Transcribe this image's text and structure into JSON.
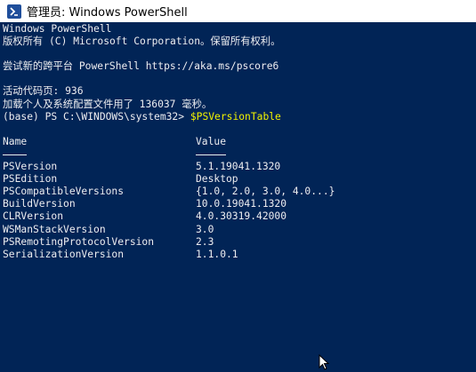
{
  "window": {
    "title": "管理员: Windows PowerShell",
    "icon": "powershell-icon"
  },
  "console": {
    "lines": [
      "Windows PowerShell",
      "版权所有 (C) Microsoft Corporation。保留所有权利。",
      "",
      "尝试新的跨平台 PowerShell https://aka.ms/pscore6",
      "",
      "活动代码页: 936",
      "加载个人及系统配置文件用了 136037 毫秒。"
    ],
    "prompt": "(base) PS C:\\WINDOWS\\system32> ",
    "command": "$PSVersionTable",
    "table": {
      "headers": [
        "Name",
        "Value"
      ],
      "rows": [
        [
          "PSVersion",
          "5.1.19041.1320"
        ],
        [
          "PSEdition",
          "Desktop"
        ],
        [
          "PSCompatibleVersions",
          "{1.0, 2.0, 3.0, 4.0...}"
        ],
        [
          "BuildVersion",
          "10.0.19041.1320"
        ],
        [
          "CLRVersion",
          "4.0.30319.42000"
        ],
        [
          "WSManStackVersion",
          "3.0"
        ],
        [
          "PSRemotingProtocolVersion",
          "2.3"
        ],
        [
          "SerializationVersion",
          "1.1.0.1"
        ]
      ]
    }
  },
  "colors": {
    "background": "#012456",
    "text": "#eeedf0",
    "command": "#f2f200"
  }
}
